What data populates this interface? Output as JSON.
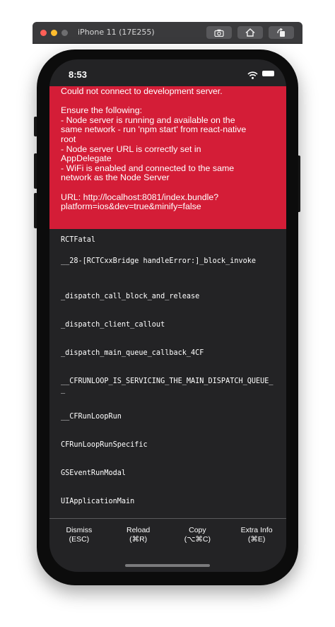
{
  "simulator": {
    "title": "iPhone 11 (17E255)",
    "buttons": [
      {
        "icon": "screenshot-icon"
      },
      {
        "icon": "home-icon"
      },
      {
        "icon": "rotate-icon"
      }
    ]
  },
  "status_bar": {
    "time": "8:53",
    "icons": [
      "wifi-icon",
      "battery-icon"
    ]
  },
  "error": {
    "lines": [
      "Could not connect to development server.",
      "",
      "Ensure the following:",
      "- Node server is running and available on the",
      "same network - run 'npm start' from react-native",
      "root",
      "- Node server URL is correctly set in",
      "AppDelegate",
      "- WiFi is enabled and connected to the same",
      "network as the Node Server",
      "",
      "URL: http://localhost:8081/index.bundle?",
      "platform=ios&dev=true&minify=false"
    ],
    "background": "#d41d37"
  },
  "stack_trace": [
    "RCTFatal",
    "__28-[RCTCxxBridge handleError:]_block_invoke",
    "_dispatch_call_block_and_release",
    "_dispatch_client_callout",
    "_dispatch_main_queue_callback_4CF",
    "__CFRUNLOOP_IS_SERVICING_THE_MAIN_DISPATCH_QUEUE__",
    "__CFRunLoopRun",
    "CFRunLoopRunSpecific",
    "GSEventRunModal",
    "UIApplicationMain"
  ],
  "footer": [
    {
      "label": "Dismiss",
      "shortcut": "(ESC)"
    },
    {
      "label": "Reload",
      "shortcut": "(⌘R)"
    },
    {
      "label": "Copy",
      "shortcut": "(⌥⌘C)"
    },
    {
      "label": "Extra Info",
      "shortcut": "(⌘E)"
    }
  ]
}
